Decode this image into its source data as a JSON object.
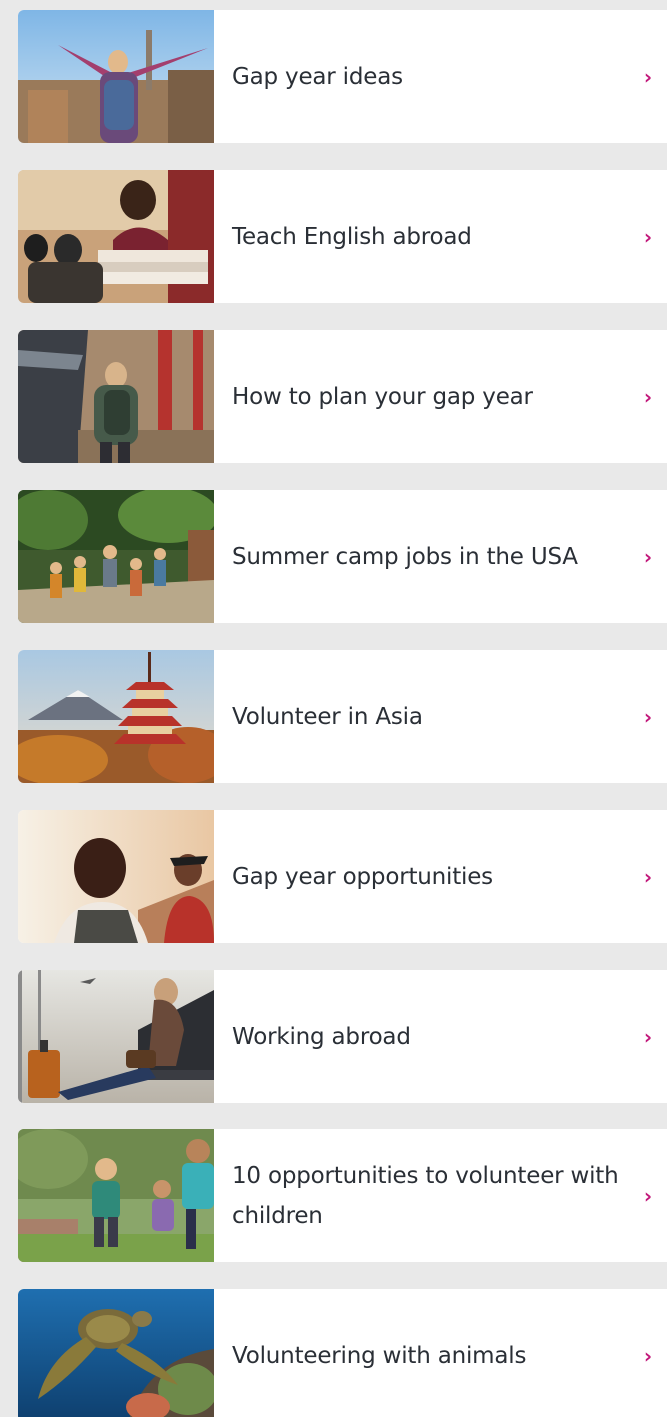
{
  "items": [
    {
      "label": "Gap year ideas",
      "image": "traveler-city-view",
      "chevron": "›"
    },
    {
      "label": "Teach English abroad",
      "image": "teacher-classroom",
      "chevron": "›"
    },
    {
      "label": "How to plan your gap year",
      "image": "backpacker-train-platform",
      "chevron": "›"
    },
    {
      "label": "Summer camp jobs in the USA",
      "image": "kids-running-camp",
      "chevron": "›"
    },
    {
      "label": "Volunteer in Asia",
      "image": "pagoda-mountain",
      "chevron": "›"
    },
    {
      "label": "Gap year opportunities",
      "image": "two-travelers-sunset",
      "chevron": "›"
    },
    {
      "label": "Working abroad",
      "image": "woman-airport-seat",
      "chevron": "›"
    },
    {
      "label": "10 opportunities to volunteer with children",
      "image": "children-playing",
      "chevron": "›"
    },
    {
      "label": "Volunteering with animals",
      "image": "sea-turtle-reef",
      "chevron": "›"
    }
  ],
  "colors": {
    "background": "#e9e9e9",
    "card": "#ffffff",
    "text": "#2a2f36",
    "chevron": "#c2187a"
  }
}
